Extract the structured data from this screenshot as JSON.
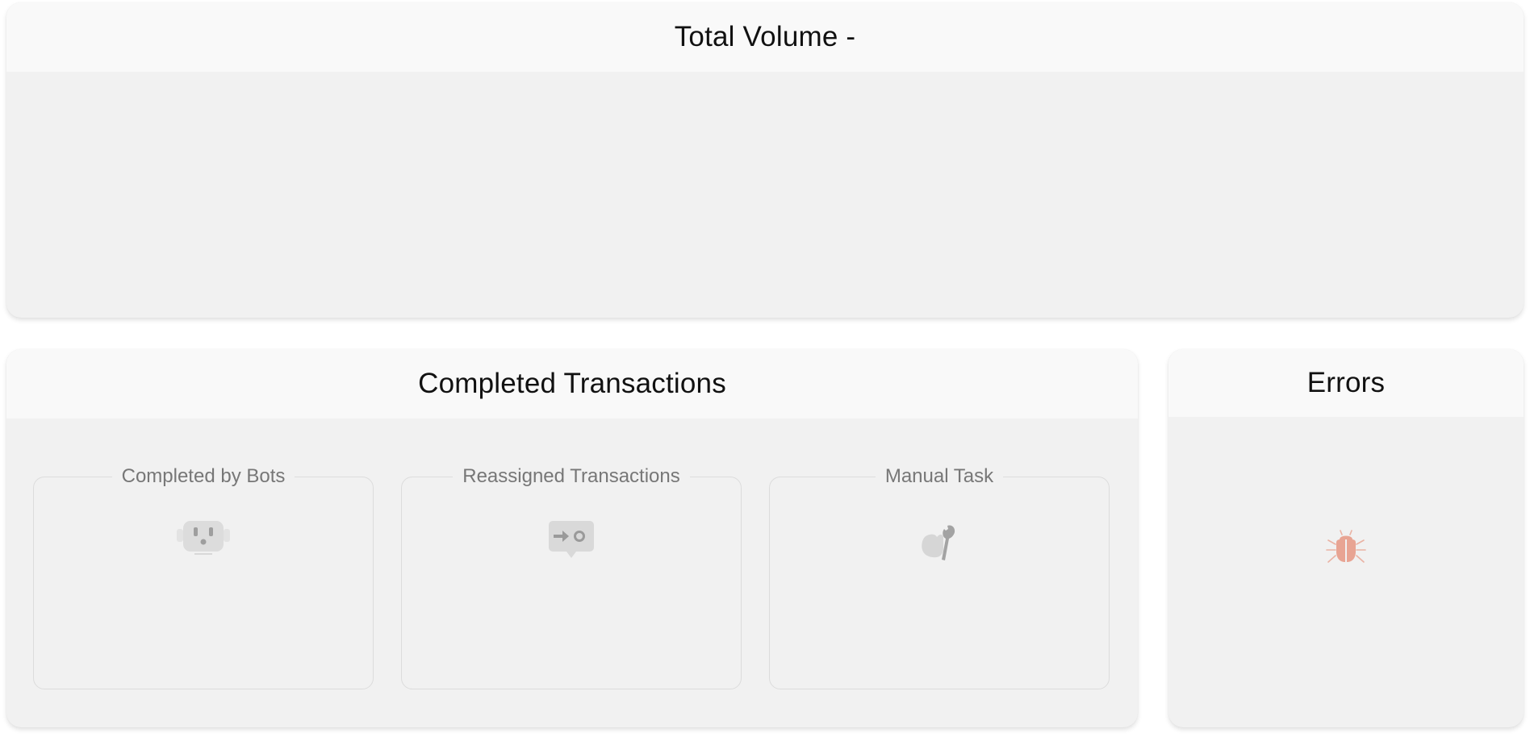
{
  "total_volume": {
    "title": "Total Volume -"
  },
  "completed_transactions": {
    "title": "Completed Transactions",
    "sections": [
      {
        "label": "Completed by Bots",
        "icon": "robot-icon"
      },
      {
        "label": "Reassigned Transactions",
        "icon": "reassign-icon"
      },
      {
        "label": "Manual Task",
        "icon": "wrench-hand-icon"
      }
    ]
  },
  "errors": {
    "title": "Errors",
    "icon": "bug-icon",
    "icon_color": "#e8a493"
  },
  "colors": {
    "card_bg": "#f1f1f1",
    "header_bg": "#f9f9f9",
    "icon_gray": "#bdbdbd",
    "text_muted": "#777777"
  }
}
